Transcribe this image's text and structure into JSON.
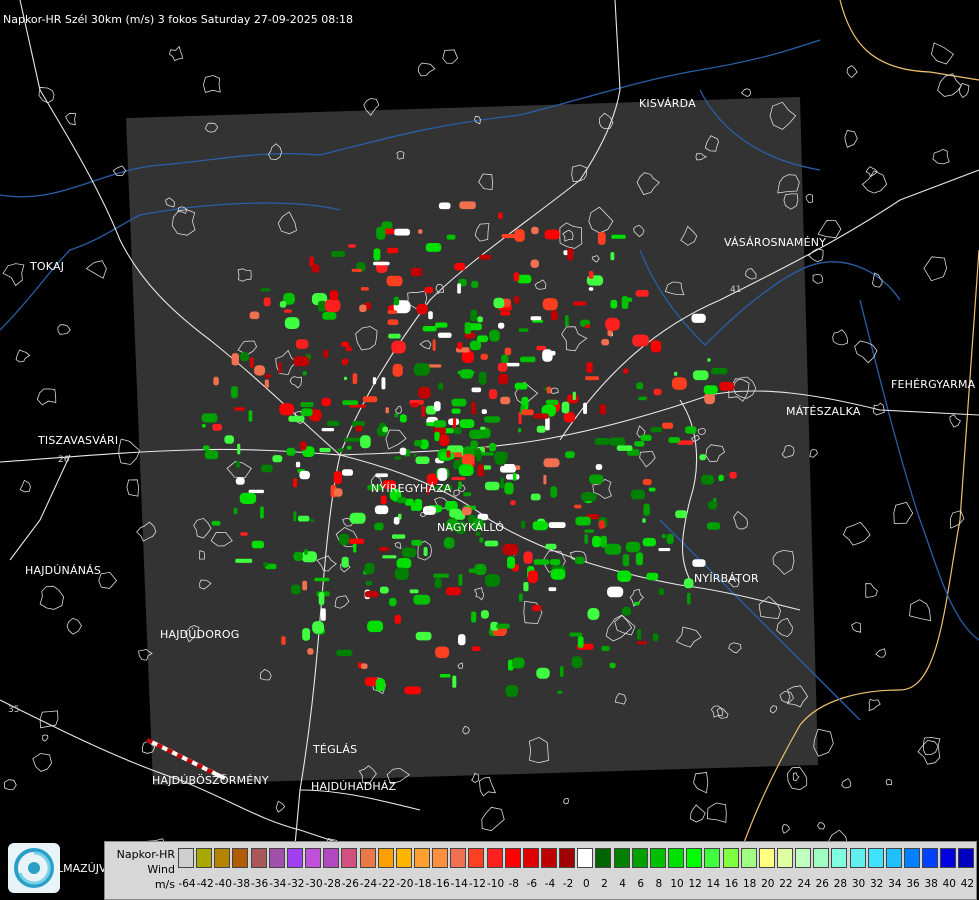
{
  "header": {
    "title": "Napkor-HR Szél 30km (m/s) 3 fokos Saturday 27-09-2025 08:18"
  },
  "places": [
    "KISVÁRDA",
    "VÁSÁROSNAMÉNY",
    "TOKAJ",
    "FEHÉRGYARMA",
    "MÁTÉSZALKA",
    "TISZAVASVÁRI",
    "NYÍREGYHÁZA",
    "NAGYKÁLLÓ",
    "NYÍRBÁTOR",
    "HAJDÚNÁNÁS",
    "HAJDÚDOROG",
    "TÉGLÁS",
    "HAJDÚBÖSZÖRMÉNY",
    "HAJDÚHADHÁZ",
    "LMAZÚJVÁR"
  ],
  "road_numbers": [
    "26",
    "35",
    "41"
  ],
  "legend": {
    "line1": "Napkor-HR",
    "line2": "Wind",
    "line3": "m/s",
    "ticks": [
      "-64",
      "-42",
      "-40",
      "-38",
      "-36",
      "-34",
      "-32",
      "-30",
      "-28",
      "-26",
      "-24",
      "-22",
      "-20",
      "-18",
      "-16",
      "-14",
      "-12",
      "-10",
      "-8",
      "-6",
      "-4",
      "-2",
      "0",
      "2",
      "4",
      "6",
      "8",
      "10",
      "12",
      "14",
      "16",
      "18",
      "20",
      "22",
      "24",
      "26",
      "28",
      "30",
      "32",
      "34",
      "36",
      "38",
      "40",
      "42"
    ],
    "colors": [
      "#cfcfcf",
      "#a8a800",
      "#b48400",
      "#b05c00",
      "#a85858",
      "#a050a8",
      "#a040f0",
      "#c050d8",
      "#b048c0",
      "#d05080",
      "#e87848",
      "#ffa000",
      "#ffb400",
      "#ffa030",
      "#ff9040",
      "#f07050",
      "#ff4020",
      "#ff2020",
      "#ff0000",
      "#e00000",
      "#c00000",
      "#a00000",
      "#ffffff",
      "#006400",
      "#008000",
      "#00a000",
      "#00c000",
      "#00e000",
      "#00ff00",
      "#40ff40",
      "#80ff40",
      "#a0ff80",
      "#ffff80",
      "#e0ffa0",
      "#c0ffc0",
      "#a0ffc0",
      "#80ffe0",
      "#60f0f0",
      "#40e0ff",
      "#20c0ff",
      "#0080ff",
      "#0040ff",
      "#0000e0",
      "#0000c0"
    ]
  },
  "colors": {
    "background": "#000000",
    "radar_area": "#333333",
    "road": "#ffffff",
    "river": "#2a5fa8",
    "border": "#f0c070"
  },
  "icons": {
    "logo": "napkor-logo-icon"
  }
}
